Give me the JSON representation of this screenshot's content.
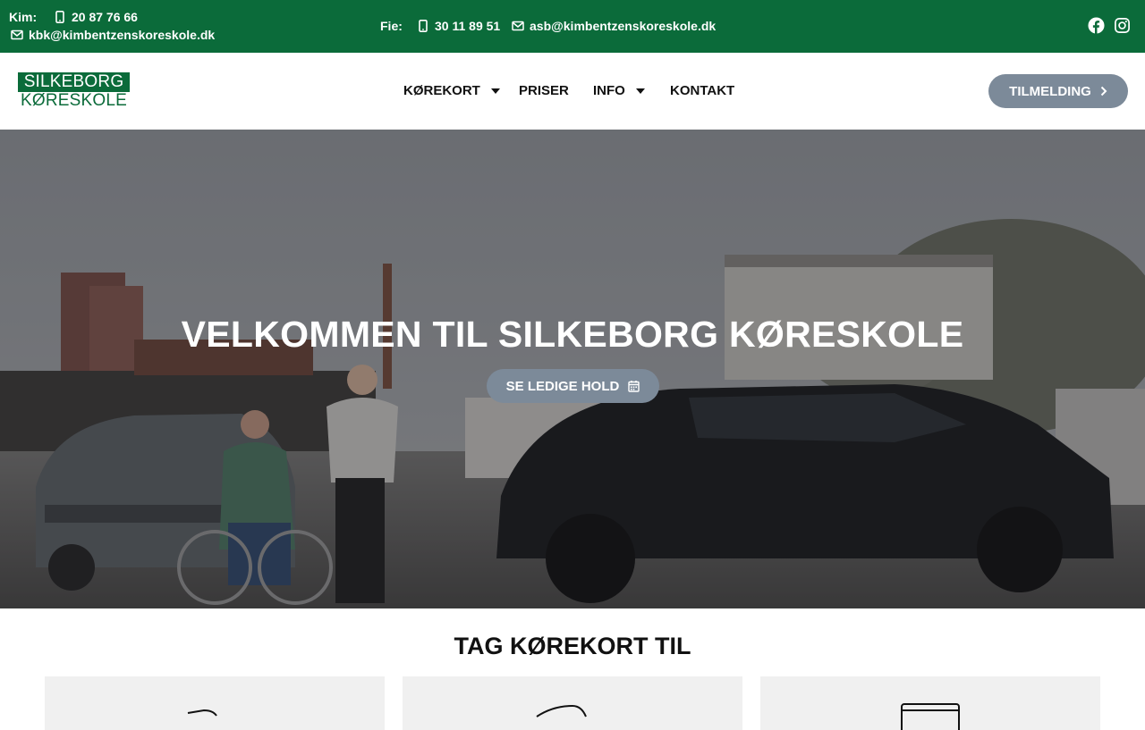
{
  "topbar": {
    "kim_label": "Kim:",
    "kim_phone": "20 87 76 66",
    "kim_email": "kbk@kimbentzenskoreskole.dk",
    "fie_label": "Fie:",
    "fie_phone": "30 11 89 51",
    "fie_email": "asb@kimbentzenskoreskole.dk",
    "social": [
      "facebook-icon",
      "instagram-icon"
    ]
  },
  "logo": {
    "line1": "SILKEBORG",
    "line2": "KØRESKOLE"
  },
  "nav": {
    "items": [
      {
        "label": "KØREKORT",
        "dropdown": true
      },
      {
        "label": "PRISER",
        "dropdown": false
      },
      {
        "label": "INFO",
        "dropdown": true
      },
      {
        "label": "KONTAKT",
        "dropdown": false
      }
    ],
    "cta_label": "TILMELDING"
  },
  "hero": {
    "title": "VELKOMMEN TIL SILKEBORG KØRESKOLE",
    "button_label": "SE LEDIGE HOLD"
  },
  "section": {
    "title": "TAG KØREKORT TIL"
  },
  "colors": {
    "brand_green": "#0b6b3a",
    "button_gray": "#7c8a99",
    "card_bg": "#f0f0f0"
  }
}
